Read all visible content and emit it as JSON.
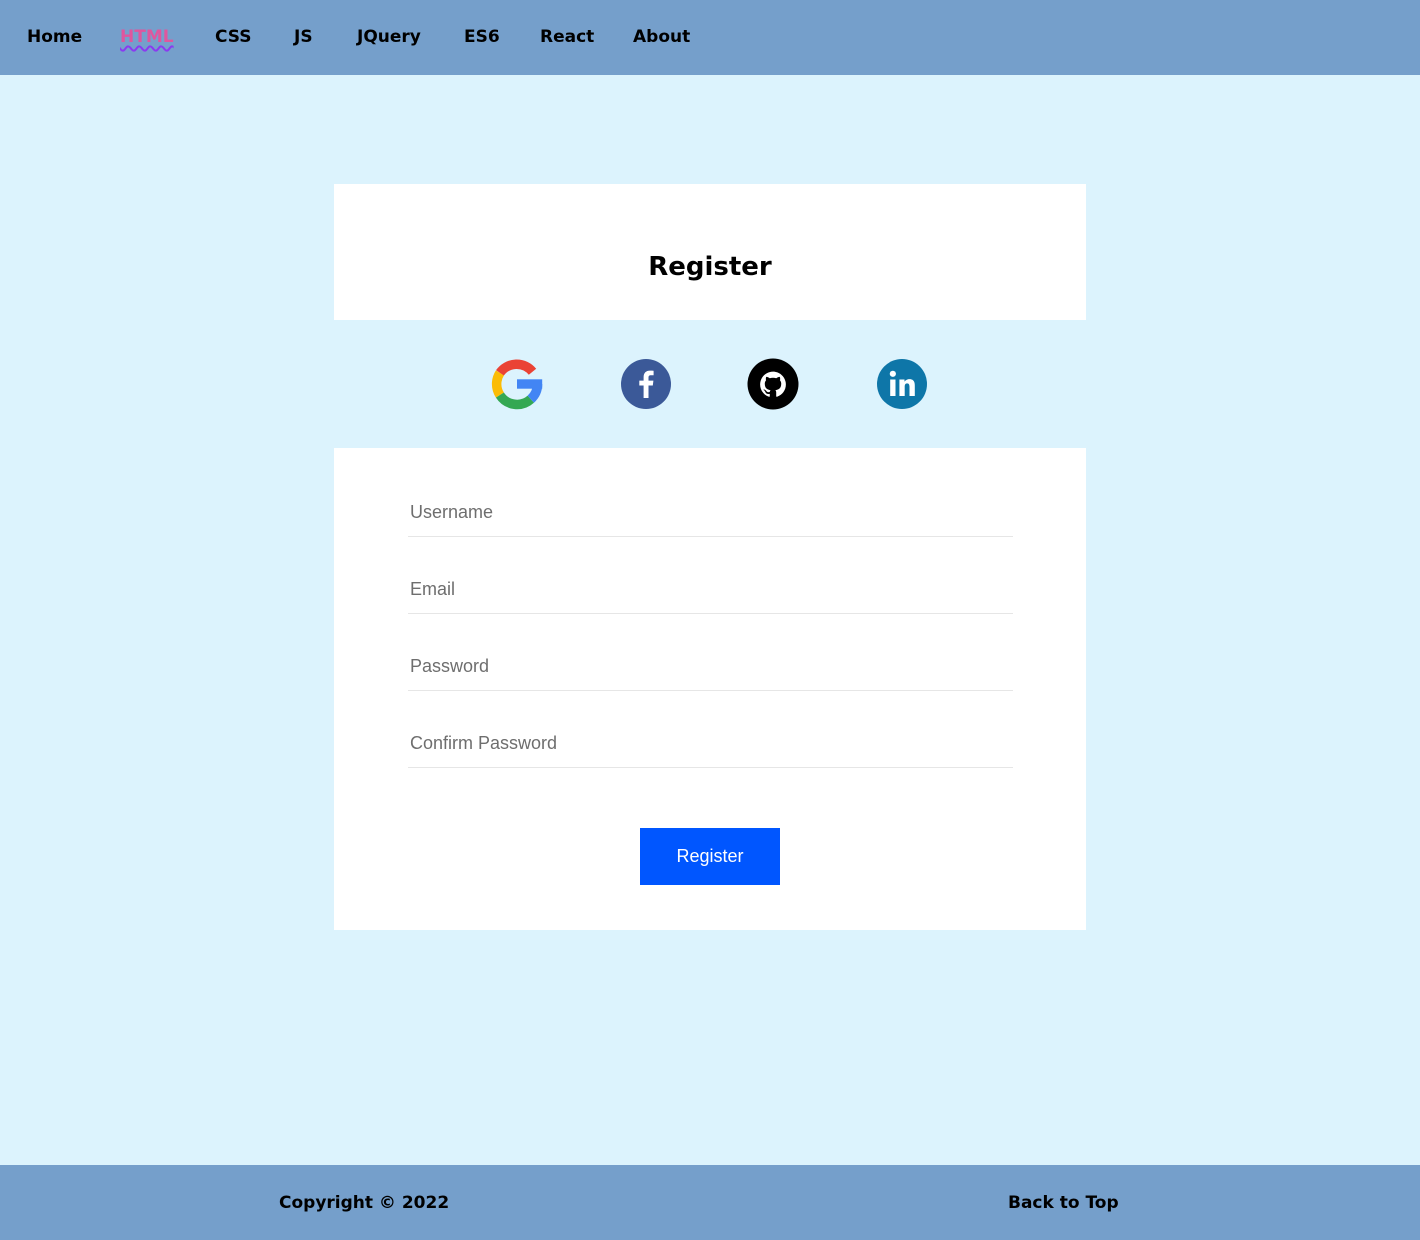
{
  "nav": {
    "items": [
      {
        "label": "Home",
        "active": false
      },
      {
        "label": "HTML",
        "active": true
      },
      {
        "label": "CSS",
        "active": false
      },
      {
        "label": "JS",
        "active": false
      },
      {
        "label": "JQuery",
        "active": false
      },
      {
        "label": "ES6",
        "active": false
      },
      {
        "label": "React",
        "active": false
      },
      {
        "label": "About",
        "active": false
      }
    ]
  },
  "card": {
    "title": "Register",
    "social": [
      {
        "icon": "google-icon"
      },
      {
        "icon": "facebook-icon",
        "color": "#3b5998"
      },
      {
        "icon": "github-icon",
        "color": "#000000"
      },
      {
        "icon": "linkedin-icon",
        "color": "#0e76a8"
      }
    ],
    "fields": {
      "username_placeholder": "Username",
      "email_placeholder": "Email",
      "password_placeholder": "Password",
      "confirm_placeholder": "Confirm Password"
    },
    "submit_label": "Register"
  },
  "footer": {
    "copyright": "Copyright © 2022",
    "back_to_top": "Back to Top"
  },
  "colors": {
    "page_bg": "#dcf3fd",
    "bar_bg": "#759fcb",
    "button": "#0056ff",
    "active_nav": "#e0569e"
  }
}
